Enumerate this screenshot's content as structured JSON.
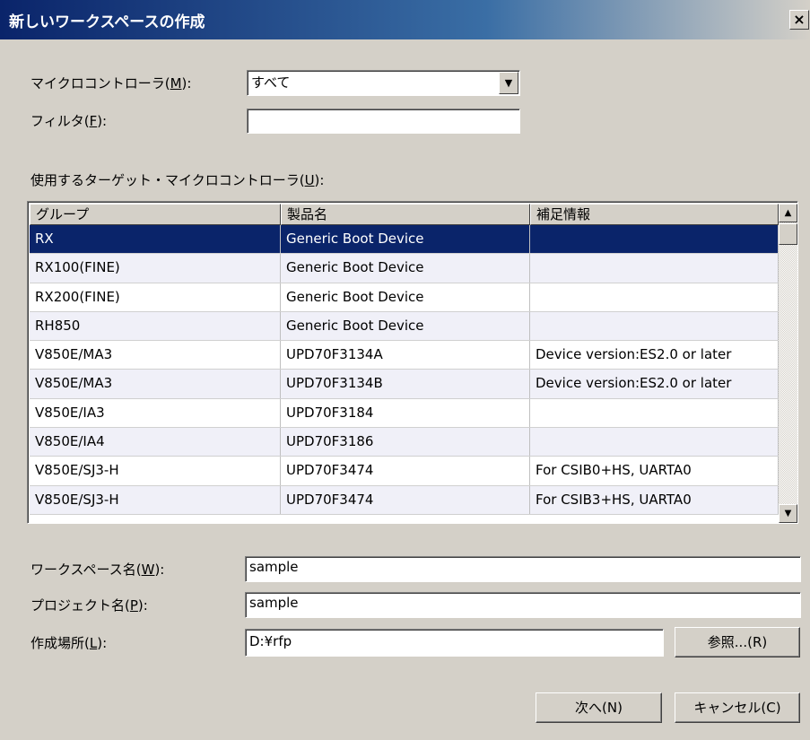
{
  "window": {
    "title": "新しいワークスペースの作成",
    "close_glyph": "×"
  },
  "form": {
    "microcontroller_label": "マイクロコントローラ(",
    "microcontroller_mnemonic": "M",
    "microcontroller_label_end": "):",
    "microcontroller_value": "すべて",
    "filter_label": "フィルタ(",
    "filter_mnemonic": "F",
    "filter_label_end": "):",
    "filter_value": "",
    "target_label": "使用するターゲット・マイクロコントローラ(",
    "target_mnemonic": "U",
    "target_label_end": "):"
  },
  "table": {
    "columns": [
      "グループ",
      "製品名",
      "補足情報"
    ],
    "rows": [
      [
        "RX",
        "Generic Boot Device",
        ""
      ],
      [
        "RX100(FINE)",
        "Generic Boot Device",
        ""
      ],
      [
        "RX200(FINE)",
        "Generic Boot Device",
        ""
      ],
      [
        "RH850",
        "Generic Boot Device",
        ""
      ],
      [
        "V850E/MA3",
        "UPD70F3134A",
        "Device version:ES2.0 or later"
      ],
      [
        "V850E/MA3",
        "UPD70F3134B",
        "Device version:ES2.0 or later"
      ],
      [
        "V850E/IA3",
        "UPD70F3184",
        ""
      ],
      [
        "V850E/IA4",
        "UPD70F3186",
        ""
      ],
      [
        "V850E/SJ3-H",
        "UPD70F3474",
        "For CSIB0+HS, UARTA0"
      ],
      [
        "V850E/SJ3-H",
        "UPD70F3474",
        "For CSIB3+HS, UARTA0"
      ]
    ],
    "selected_row": 0
  },
  "workspace": {
    "name_label": "ワークスペース名(",
    "name_mnemonic": "W",
    "name_label_end": "):",
    "name_value": "sample",
    "project_label": "プロジェクト名(",
    "project_mnemonic": "P",
    "project_label_end": "):",
    "project_value": "sample",
    "location_label": "作成場所(",
    "location_mnemonic": "L",
    "location_label_end": "):",
    "location_value": "D:¥rfp",
    "browse_button": "参照...(R)"
  },
  "buttons": {
    "next": "次へ(N)",
    "cancel": "キャンセル(C)"
  },
  "colors": {
    "title_bar": "#0a246a",
    "selection": "#0a246a",
    "face": "#d4d0c8"
  }
}
